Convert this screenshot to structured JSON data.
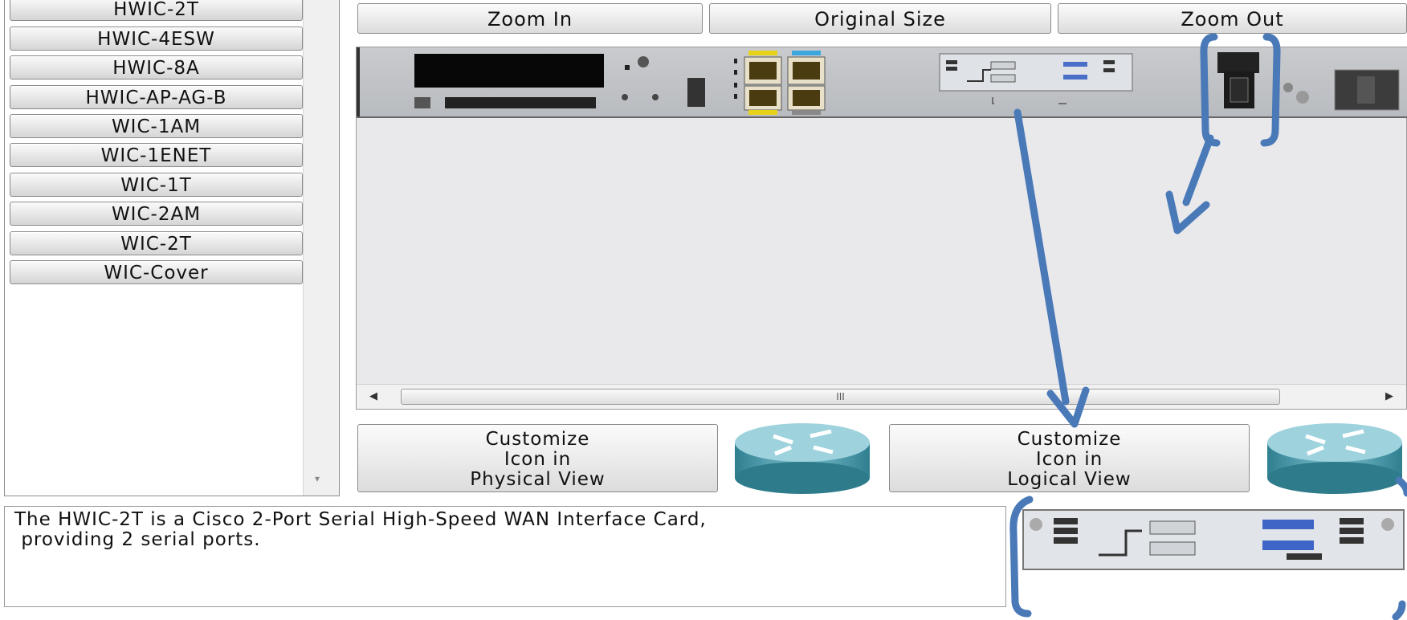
{
  "modules": [
    "HWIC-2T",
    "HWIC-4ESW",
    "HWIC-8A",
    "HWIC-AP-AG-B",
    "WIC-1AM",
    "WIC-1ENET",
    "WIC-1T",
    "WIC-2AM",
    "WIC-2T",
    "WIC-Cover"
  ],
  "toolbar": {
    "zoom_in": "Zoom In",
    "original_size": "Original Size",
    "zoom_out": "Zoom Out"
  },
  "customize": {
    "physical": [
      "Customize",
      "Icon in",
      "Physical View"
    ],
    "logical": [
      "Customize",
      "Icon in",
      "Logical View"
    ]
  },
  "description": "The HWIC-2T is a Cisco 2-Port Serial High-Speed WAN Interface Card,\n providing 2 serial ports.",
  "colors": {
    "annotation": "#4a79b8",
    "router": "#3a8c9c"
  }
}
